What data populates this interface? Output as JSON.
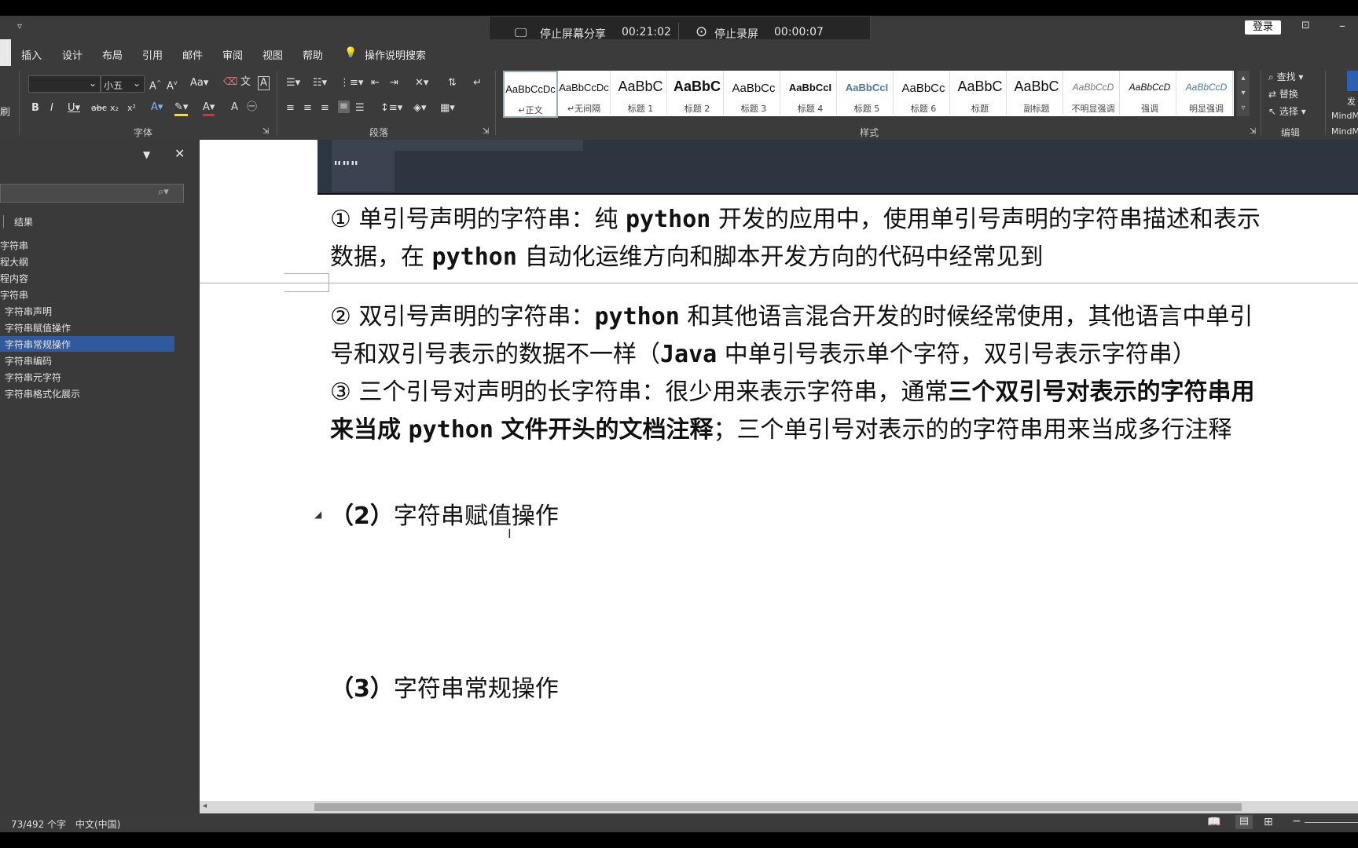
{
  "window": {
    "login_label": "登录"
  },
  "overlay": {
    "share_label": "停止屏幕分享",
    "share_time": "00:21:02",
    "record_label": "停止录屏",
    "record_time": "00:00:07"
  },
  "tabs": [
    "插入",
    "设计",
    "布局",
    "引用",
    "邮件",
    "审阅",
    "视图",
    "帮助"
  ],
  "search_tab": "操作说明搜索",
  "ribbon": {
    "font_size": "小五",
    "groups": {
      "font": "字体",
      "paragraph": "段落",
      "styles": "样式",
      "edit": "编辑"
    },
    "clipboard_fragment": "刷",
    "styles": [
      {
        "sample": "AaBbCcDc",
        "name": "↵正文"
      },
      {
        "sample": "AaBbCcDc",
        "name": "↵无间隔"
      },
      {
        "sample": "AaBbC",
        "name": "标题 1"
      },
      {
        "sample": "AaBbC",
        "name": "标题 2"
      },
      {
        "sample": "AaBbCc",
        "name": "标题 3"
      },
      {
        "sample": "AaBbCcI",
        "name": "标题 4"
      },
      {
        "sample": "AaBbCcI",
        "name": "标题 5"
      },
      {
        "sample": "AaBbCc",
        "name": "标题 6"
      },
      {
        "sample": "AaBbC",
        "name": "标题"
      },
      {
        "sample": "AaBbC",
        "name": "副标题"
      },
      {
        "sample": "AaBbCcD",
        "name": "不明显强调"
      },
      {
        "sample": "AaBbCcD",
        "name": "强调"
      },
      {
        "sample": "AaBbCcD",
        "name": "明显强调"
      }
    ],
    "edit": {
      "find": "查找",
      "replace": "替换",
      "select": "选择"
    },
    "mindmap": {
      "a": "发",
      "b": "MindM",
      "c": "MindM"
    }
  },
  "nav": {
    "results_label": "结果",
    "items": [
      "字符串",
      "程大纲",
      "程内容",
      "字符串",
      "字符串声明",
      "字符串赋值操作",
      "字符串常规操作",
      "字符串编码",
      "字符串元字符",
      "字符串格式化展示"
    ],
    "selected_index": 6
  },
  "doc": {
    "code_quote": "\"\"\"",
    "p1_circle": "①",
    "p1_a": "单引号声明的字符串：纯",
    "p1_code": "python",
    "p1_b": "开发的应用中，使用单引号声明的字符串描述和表示",
    "p1_c": "数据，在",
    "p1_code2": "python",
    "p1_d": "自动化运维方向和脚本开发方向的代码中经常见到",
    "p2_circle": "②",
    "p2_a": "双引号声明的字符串：",
    "p2_code": "python",
    "p2_b": "和其他语言混合开发的时候经常使用，其他语言中单引",
    "p2_c": "号和双引号表示的数据不一样（",
    "p2_code2": "Java",
    "p2_d": "中单引号表示单个字符，双引号表示字符串）",
    "p3_circle": "③",
    "p3_a": "三个引号对声明的长字符串：很少用来表示字符串，通常",
    "p3_bold1": "三个双引号对表示的字符串用",
    "p3_bold2": "来当成",
    "p3_code": "python",
    "p3_bold3": "文件开头的文档注释",
    "p3_b": "；三个单引号对表示的的字符串用来当成多行注释",
    "h2_num": "（2）",
    "h2_text": "字符串赋值操作",
    "h3_num": "（3）",
    "h3_text": "字符串常规操作"
  },
  "status": {
    "word_count": "73/492 个字",
    "language": "中文(中国)"
  }
}
